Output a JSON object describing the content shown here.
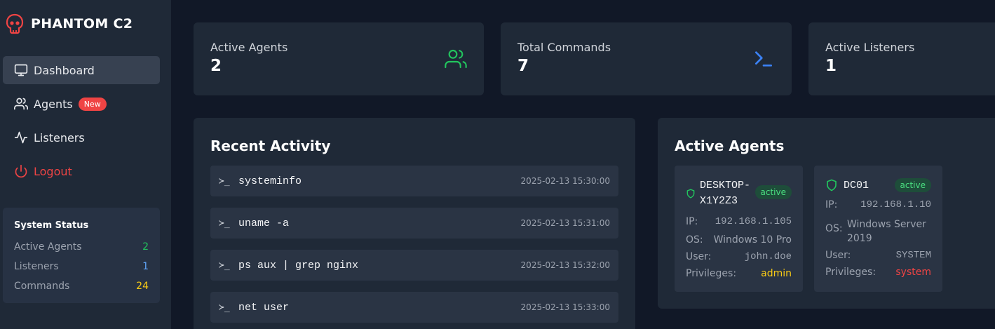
{
  "brand": {
    "title": "PHANTOM C2",
    "icon": "skull-icon",
    "color": "#ef4444"
  },
  "nav": [
    {
      "label": "Dashboard",
      "icon": "monitor-icon"
    },
    {
      "label": "Agents",
      "icon": "users-icon",
      "badge": "New"
    },
    {
      "label": "Listeners",
      "icon": "activity-icon"
    },
    {
      "label": "Logout",
      "icon": "power-icon"
    }
  ],
  "system_status": {
    "title": "System Status",
    "rows": [
      {
        "label": "Active Agents",
        "value": "2"
      },
      {
        "label": "Listeners",
        "value": "1"
      },
      {
        "label": "Commands",
        "value": "24"
      }
    ]
  },
  "stats": [
    {
      "label": "Active Agents",
      "value": "2",
      "icon": "users-icon",
      "color": "#22c55e"
    },
    {
      "label": "Total Commands",
      "value": "7",
      "icon": "terminal-icon",
      "color": "#3b82f6"
    },
    {
      "label": "Active Listeners",
      "value": "1"
    }
  ],
  "recent_activity": {
    "title": "Recent Activity",
    "items": [
      {
        "cmd": "systeminfo",
        "time": "2025-02-13 15:30:00"
      },
      {
        "cmd": "uname -a",
        "time": "2025-02-13 15:31:00"
      },
      {
        "cmd": "ps aux | grep nginx",
        "time": "2025-02-13 15:32:00"
      },
      {
        "cmd": "net user",
        "time": "2025-02-13 15:33:00"
      }
    ]
  },
  "active_agents": {
    "title": "Active Agents",
    "agents": [
      {
        "name_line1": "DESKTOP-",
        "name_line2": "X1Y2Z3",
        "status": "active",
        "ip_label": "IP:",
        "ip": "192.168.1.105",
        "os_label": "OS:",
        "os": "Windows 10 Pro",
        "user_label": "User:",
        "user": "john.doe",
        "priv_label": "Privileges:",
        "privileges": "admin"
      },
      {
        "name_line1": "DC01",
        "status": "active",
        "ip_label": "IP:",
        "ip": "192.168.1.10",
        "os_label": "OS:",
        "os_line1": "Windows Server",
        "os_line2": "2019",
        "user_label": "User:",
        "user": "SYSTEM",
        "priv_label": "Privileges:",
        "privileges": "system"
      }
    ]
  },
  "prompt_glyph": "≻_"
}
